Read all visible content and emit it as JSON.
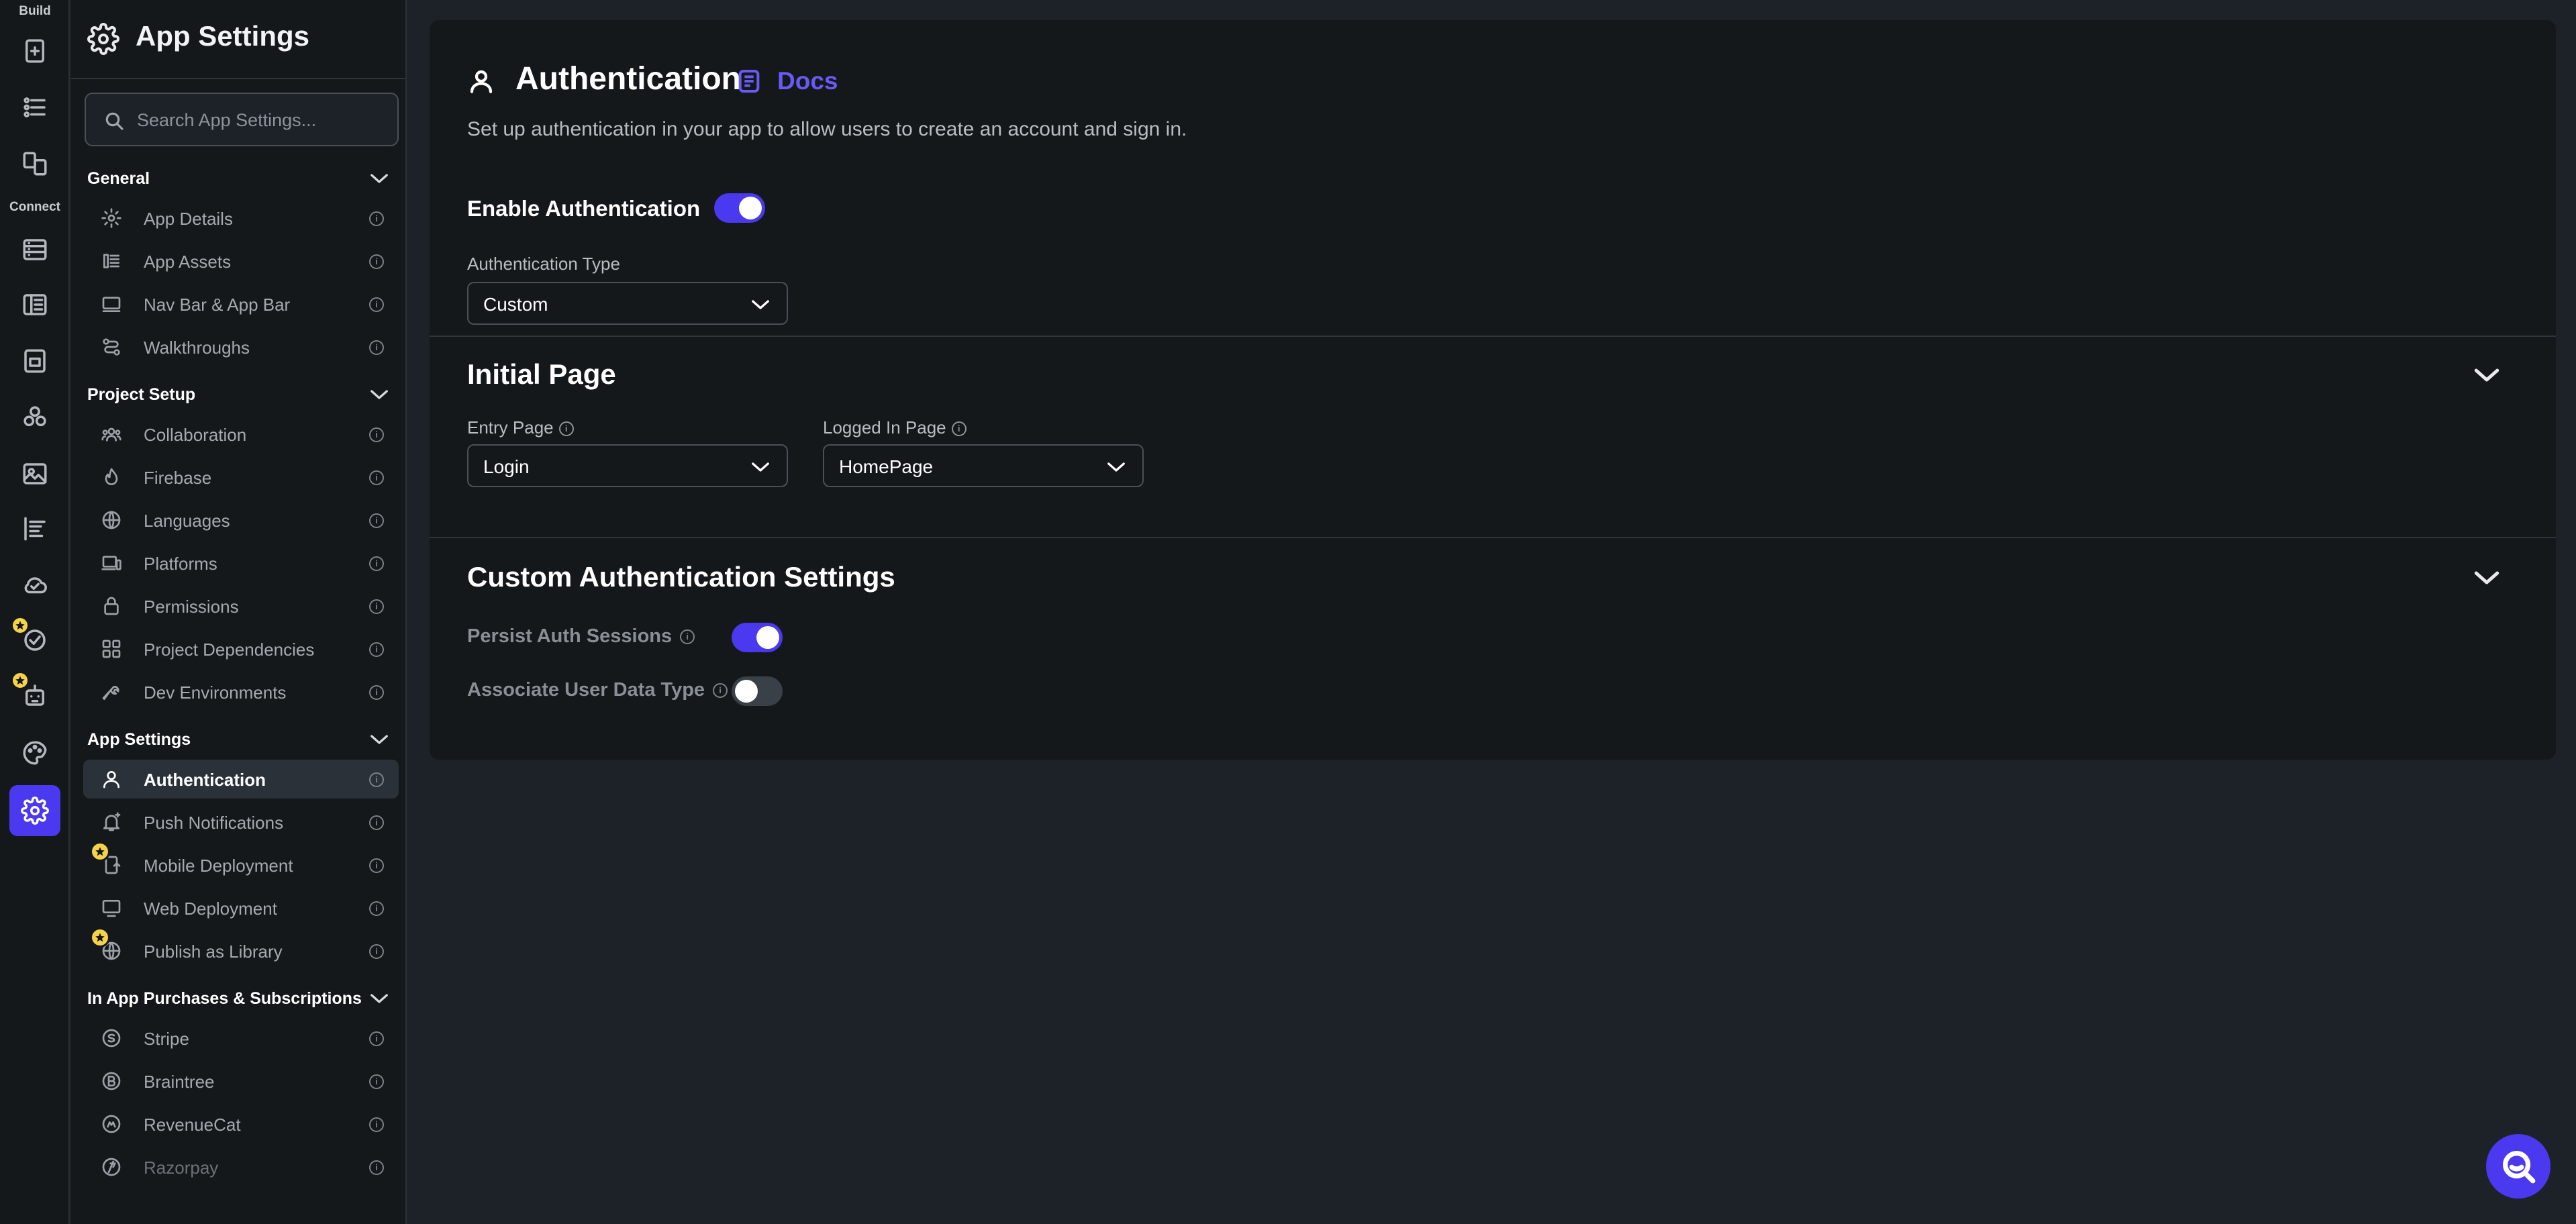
{
  "rail": {
    "build_label": "Build",
    "connect_label": "Connect"
  },
  "sidebar": {
    "title": "App Settings",
    "search_placeholder": "Search App Settings...",
    "groups": [
      {
        "title": "General",
        "items": [
          {
            "label": "App Details",
            "icon": "app-details-icon"
          },
          {
            "label": "App Assets",
            "icon": "app-assets-icon"
          },
          {
            "label": "Nav Bar & App Bar",
            "icon": "nav-bar-icon"
          },
          {
            "label": "Walkthroughs",
            "icon": "walkthroughs-icon"
          }
        ]
      },
      {
        "title": "Project Setup",
        "items": [
          {
            "label": "Collaboration",
            "icon": "collaboration-icon"
          },
          {
            "label": "Firebase",
            "icon": "firebase-icon"
          },
          {
            "label": "Languages",
            "icon": "globe-icon"
          },
          {
            "label": "Platforms",
            "icon": "devices-icon"
          },
          {
            "label": "Permissions",
            "icon": "lock-icon"
          },
          {
            "label": "Project Dependencies",
            "icon": "grid-icon"
          },
          {
            "label": "Dev Environments",
            "icon": "wrench-icon"
          }
        ]
      },
      {
        "title": "App Settings",
        "items": [
          {
            "label": "Authentication",
            "icon": "person-icon",
            "selected": true
          },
          {
            "label": "Push Notifications",
            "icon": "bell-icon"
          },
          {
            "label": "Mobile Deployment",
            "icon": "mobile-deploy-icon",
            "badge": "star"
          },
          {
            "label": "Web Deployment",
            "icon": "monitor-icon"
          },
          {
            "label": "Publish as Library",
            "icon": "globe-icon",
            "badge": "star"
          }
        ]
      },
      {
        "title": "In App Purchases & Subscriptions",
        "items": [
          {
            "label": "Stripe",
            "icon": "stripe-icon"
          },
          {
            "label": "Braintree",
            "icon": "braintree-icon"
          },
          {
            "label": "RevenueCat",
            "icon": "revenuecat-icon"
          },
          {
            "label": "Razorpay",
            "icon": "razorpay-icon"
          }
        ]
      }
    ]
  },
  "main": {
    "title": "Authentication",
    "docs_label": "Docs",
    "subtitle": "Set up authentication in your app to allow users to create an account and sign in.",
    "enable_label": "Enable Authentication",
    "enable_on": true,
    "auth_type_label": "Authentication Type",
    "auth_type_value": "Custom",
    "initial_page": {
      "title": "Initial Page",
      "entry_label": "Entry Page",
      "entry_value": "Login",
      "logged_in_label": "Logged In Page",
      "logged_in_value": "HomePage"
    },
    "custom_auth": {
      "title": "Custom Authentication Settings",
      "persist_label": "Persist Auth Sessions",
      "persist_on": true,
      "associate_label": "Associate User Data Type",
      "associate_on": false
    }
  },
  "colors": {
    "accent": "#4b39ef",
    "docs_link": "#6a5af4",
    "background": "#1d2229",
    "panel": "#14181b",
    "star_badge": "#f4d24a"
  }
}
